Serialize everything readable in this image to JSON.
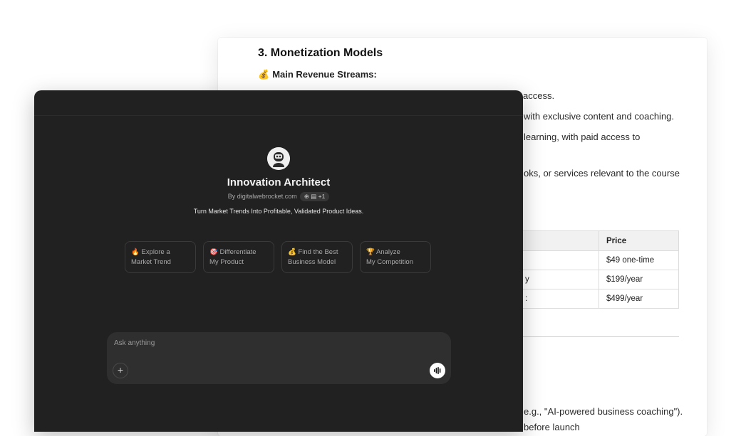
{
  "document": {
    "heading": "3. Monetization Models",
    "subheading_emoji": "💰",
    "subheading": "Main Revenue Streams:",
    "lines": [
      "access.",
      "with exclusive content and coaching.",
      "learning, with paid access to",
      "oks, or services relevant to the course"
    ],
    "table": {
      "header": [
        "",
        "Price"
      ],
      "rows": [
        [
          "",
          "$49 one-time"
        ],
        [
          "y",
          "$199/year"
        ],
        [
          ":",
          "$499/year"
        ]
      ]
    },
    "bottom_lines": [
      "e.g., \"AI-powered business coaching\").",
      "before launch"
    ]
  },
  "gpt": {
    "name": "Innovation Architect",
    "byline": "By digitalwebrocket.com",
    "byline_chip": "⊕ ▤ +1",
    "tagline": "Turn Market Trends Into Profitable, Validated Product Ideas.",
    "starters": [
      {
        "emoji": "🔥",
        "line1": "Explore a",
        "line2": "Market Trend"
      },
      {
        "emoji": "🎯",
        "line1": "Differentiate",
        "line2": "My Product"
      },
      {
        "emoji": "💰",
        "line1": "Find the Best",
        "line2": "Business Model"
      },
      {
        "emoji": "🏆",
        "line1": "Analyze",
        "line2": "My Competition"
      }
    ],
    "composer": {
      "placeholder": "Ask anything",
      "plus_icon": "+",
      "voice_icon": "voice-waveform-icon"
    }
  }
}
